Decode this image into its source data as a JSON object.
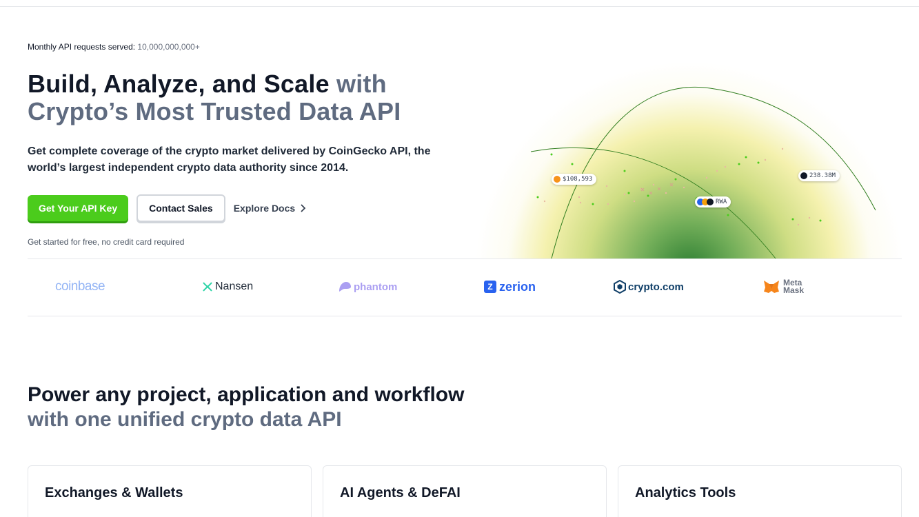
{
  "hero": {
    "stat_label": "Monthly API requests served:",
    "stat_value": "10,000,000,000+",
    "headline_dark": "Build, Analyze, and Scale",
    "headline_muted_1": "with",
    "headline_muted_2": "Crypto’s Most Trusted Data API",
    "subheadline": "Get complete coverage of the crypto market delivered by CoinGecko API, the world’s largest independent crypto data authority since 2014.",
    "cta_primary": "Get Your API Key",
    "cta_secondary": "Contact Sales",
    "cta_docs": "Explore Docs",
    "note": "Get started for free, no credit card required"
  },
  "visual": {
    "pill_btc": "$108,593",
    "pill_rwa": "RWA",
    "pill_vol": "238.38M",
    "colors": {
      "btc": "#f7931a",
      "green": "#4bcc1c"
    }
  },
  "logos": [
    {
      "name": "coinbase",
      "color": "#93b4f5",
      "icon": "none"
    },
    {
      "name": "Nansen",
      "color": "#1f2937",
      "icon": "nansen-icon"
    },
    {
      "name": "phantom",
      "color": "#ab9ff2",
      "icon": "phantom-icon"
    },
    {
      "name": "zerion",
      "color": "#2962ef",
      "icon": "zerion-icon"
    },
    {
      "name": "crypto.com",
      "color": "#103f68",
      "icon": "crypto-com-icon"
    },
    {
      "name_line1": "Meta",
      "name_line2": "Mask",
      "color": "#6b7280",
      "icon": "fox-icon"
    }
  ],
  "section": {
    "title_dark": "Power any project, application and workflow",
    "title_muted": "with one unified crypto data API"
  },
  "cards": [
    {
      "title": "Exchanges & Wallets"
    },
    {
      "title": "AI Agents & DeFAI"
    },
    {
      "title": "Analytics Tools"
    }
  ]
}
